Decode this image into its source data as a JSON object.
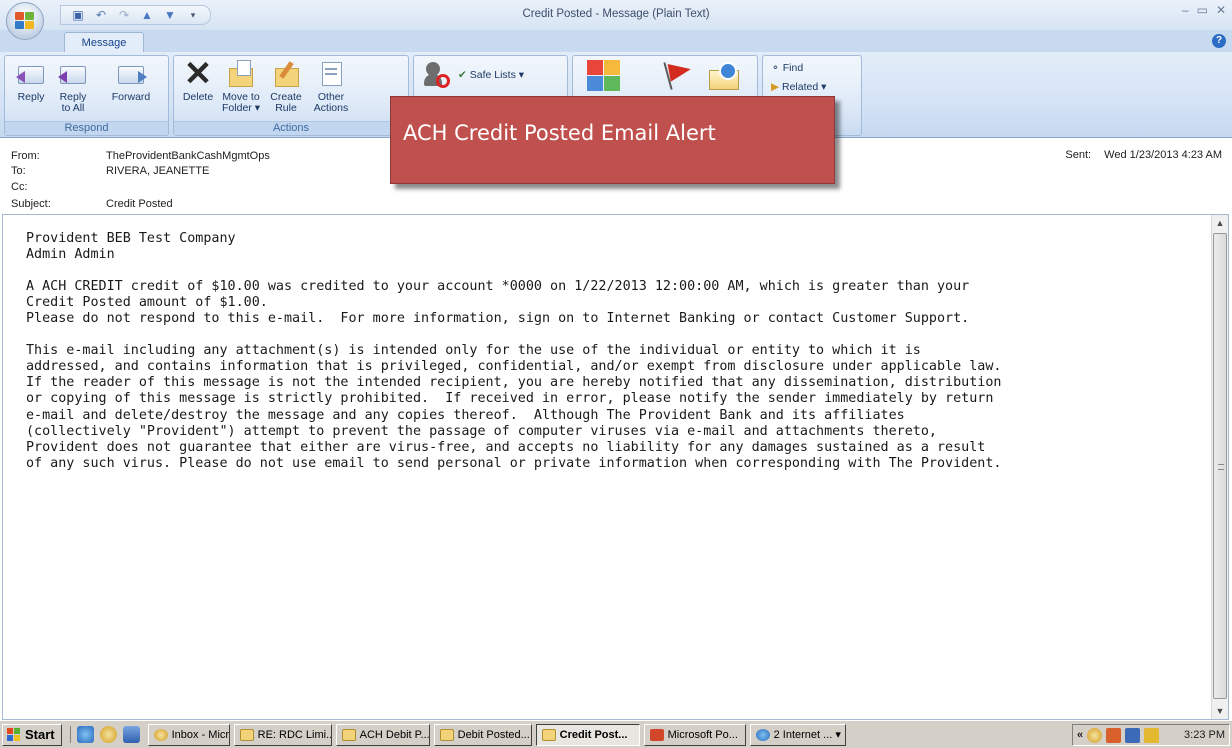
{
  "window": {
    "title": "Credit Posted - Message (Plain Text)"
  },
  "tabs": {
    "message": "Message"
  },
  "ribbon": {
    "respond": {
      "label": "Respond",
      "reply": "Reply",
      "reply_all_1": "Reply",
      "reply_all_2": "to All",
      "forward": "Forward"
    },
    "actions": {
      "label": "Actions",
      "delete": "Delete",
      "move_1": "Move to",
      "move_2": "Folder ▾",
      "create_1": "Create",
      "create_2": "Rule",
      "other_1": "Other",
      "other_2": "Actions"
    },
    "junk": {
      "safe_lists": "Safe Lists ▾"
    },
    "find": {
      "find": "Find",
      "related": "Related ▾"
    }
  },
  "header": {
    "from_label": "From:",
    "from": "TheProvidentBankCashMgmtOps",
    "to_label": "To:",
    "to": "RIVERA, JEANETTE",
    "cc_label": "Cc:",
    "cc": "",
    "subject_label": "Subject:",
    "subject": "Credit Posted",
    "sent_label": "Sent:",
    "sent": "Wed 1/23/2013 4:23 AM"
  },
  "callout": {
    "text": "ACH Credit Posted Email Alert"
  },
  "body": {
    "text": "Provident BEB Test Company\nAdmin Admin\n\nA ACH CREDIT credit of $10.00 was credited to your account *0000 on 1/22/2013 12:00:00 AM, which is greater than your\nCredit Posted amount of $1.00.\nPlease do not respond to this e-mail.  For more information, sign on to Internet Banking or contact Customer Support.\n\nThis e-mail including any attachment(s) is intended only for the use of the individual or entity to which it is\naddressed, and contains information that is privileged, confidential, and/or exempt from disclosure under applicable law.\nIf the reader of this message is not the intended recipient, you are hereby notified that any dissemination, distribution\nor copying of this message is strictly prohibited.  If received in error, please notify the sender immediately by return\ne-mail and delete/destroy the message and any copies thereof.  Although The Provident Bank and its affiliates\n(collectively \"Provident\") attempt to prevent the passage of computer viruses via e-mail and attachments thereto,\nProvident does not guarantee that either are virus-free, and accepts no liability for any damages sustained as a result\nof any such virus. Please do not use email to send personal or private information when corresponding with The Provident."
  },
  "taskbar": {
    "start": "Start",
    "buttons": [
      "Inbox - Micr...",
      "RE: RDC Limi...",
      "ACH Debit P...",
      "Debit Posted...",
      "Credit Post...",
      "Microsoft Po...",
      "2 Internet ... ▾"
    ],
    "clock": "3:23 PM"
  },
  "colors": {
    "callout": "#c0504d",
    "ribbon": "#d4e3f5",
    "taskbar": "#d4d0c8"
  }
}
